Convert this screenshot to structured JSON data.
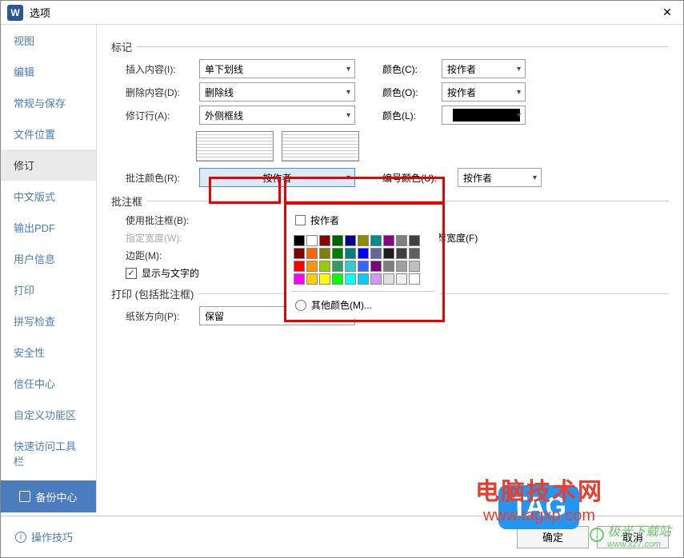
{
  "titlebar": {
    "app_letter": "W",
    "title": "选项",
    "close": "✕"
  },
  "sidebar": {
    "items": [
      {
        "label": "视图"
      },
      {
        "label": "编辑"
      },
      {
        "label": "常规与保存"
      },
      {
        "label": "文件位置"
      },
      {
        "label": "修订"
      },
      {
        "label": "中文版式"
      },
      {
        "label": "输出PDF"
      },
      {
        "label": "用户信息"
      },
      {
        "label": "打印"
      },
      {
        "label": "拼写检查"
      },
      {
        "label": "安全性"
      },
      {
        "label": "信任中心"
      },
      {
        "label": "自定义功能区"
      },
      {
        "label": "快速访问工具栏"
      }
    ],
    "backup": "备份中心"
  },
  "sections": {
    "mark": "标记",
    "comment_frame": "批注框",
    "print": "打印 (包括批注框)"
  },
  "form": {
    "insert_label": "插入内容(I):",
    "insert_value": "单下划线",
    "delete_label": "删除内容(D):",
    "delete_value": "删除线",
    "line_label": "修订行(A):",
    "line_value": "外侧框线",
    "color_c": "颜色(C):",
    "color_o": "颜色(O):",
    "color_l": "颜色(L):",
    "byauthor": "按作者",
    "annot_color_label": "批注颜色(R):",
    "annot_color_value": "按作者",
    "num_color_label": "编号颜色(U):",
    "use_frame": "使用批注框(B):",
    "fixed_width": "指定宽度(W):",
    "margin": "边距(M):",
    "show_with_text": "显示与文字的",
    "use_rec_width": "使用推荐宽度(F)",
    "paper_dir": "纸张方向(P):",
    "paper_value": "保留"
  },
  "popup": {
    "byauthor": "按作者",
    "more": "其他颜色(M)...",
    "colors": [
      [
        "#000000",
        "#ffffff",
        "#8b0000",
        "#006400",
        "#00008b",
        "#8b8b00",
        "#008b8b",
        "#8b008b",
        "#808080",
        "#404040"
      ],
      [
        "#800000",
        "#ff6600",
        "#808000",
        "#008000",
        "#008080",
        "#0000ff",
        "#666699",
        "#1f1f1f",
        "#3f3f3f",
        "#5f5f5f"
      ],
      [
        "#ff0000",
        "#ff9900",
        "#99cc00",
        "#339966",
        "#33cccc",
        "#3366ff",
        "#800080",
        "#7f7f7f",
        "#9f9f9f",
        "#bfbfbf"
      ],
      [
        "#ff00ff",
        "#ffcc00",
        "#ffff00",
        "#00ff00",
        "#00ffff",
        "#00ccff",
        "#cc99ff",
        "#dfdfdf",
        "#efefef",
        "#ffffff"
      ]
    ]
  },
  "footer": {
    "tips": "操作技巧",
    "ok": "确定",
    "cancel": "取消"
  },
  "watermark": {
    "line1": "电脑技术网",
    "line2": "www.tagxp.com",
    "tag": "TAG",
    "site": "极光下载站",
    "site_url": "www.xz7.com"
  }
}
